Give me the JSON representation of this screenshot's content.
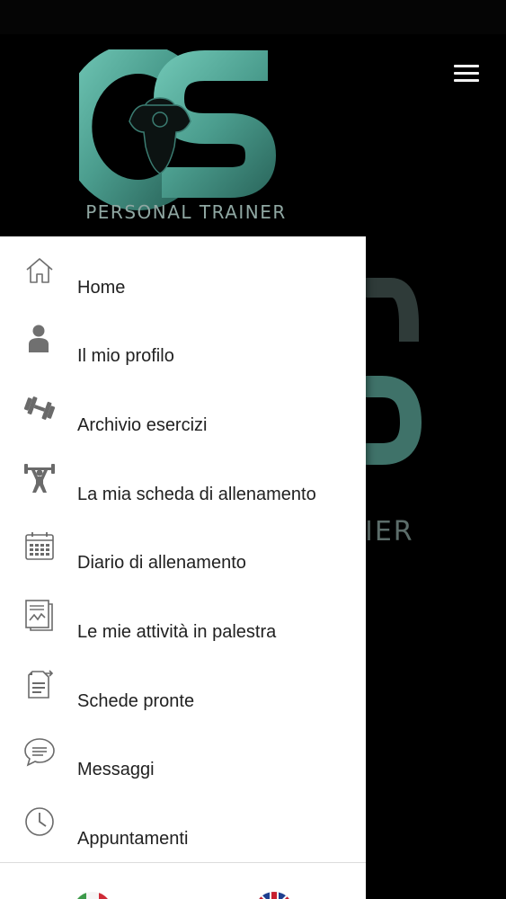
{
  "header": {
    "logo_text": "CS",
    "tagline": "PERSONAL TRAINER",
    "menu_icon": "hamburger-menu-icon"
  },
  "background": {
    "tagline_fragment": "IER"
  },
  "drawer": {
    "items": [
      {
        "label": "Home",
        "icon": "home-icon"
      },
      {
        "label": "Il mio profilo",
        "icon": "user-icon"
      },
      {
        "label": "Archivio esercizi",
        "icon": "dumbbell-icon"
      },
      {
        "label": "La mia scheda di allenamento",
        "icon": "weightlifter-icon"
      },
      {
        "label": "Diario di allenamento",
        "icon": "calendar-icon"
      },
      {
        "label": "Le mie attività in palestra",
        "icon": "activity-report-icon"
      },
      {
        "label": "Schede pronte",
        "icon": "document-transfer-icon"
      },
      {
        "label": "Messaggi",
        "icon": "chat-bubble-icon"
      },
      {
        "label": "Appuntamenti",
        "icon": "clock-icon"
      }
    ],
    "languages": [
      {
        "icon": "italy-flag-icon"
      },
      {
        "icon": "uk-flag-icon"
      }
    ]
  },
  "colors": {
    "brand_teal": "#4fa595",
    "background": "#000000",
    "drawer_background": "#ffffff",
    "menu_text": "#212121",
    "icon_gray": "#6e6e6e"
  }
}
